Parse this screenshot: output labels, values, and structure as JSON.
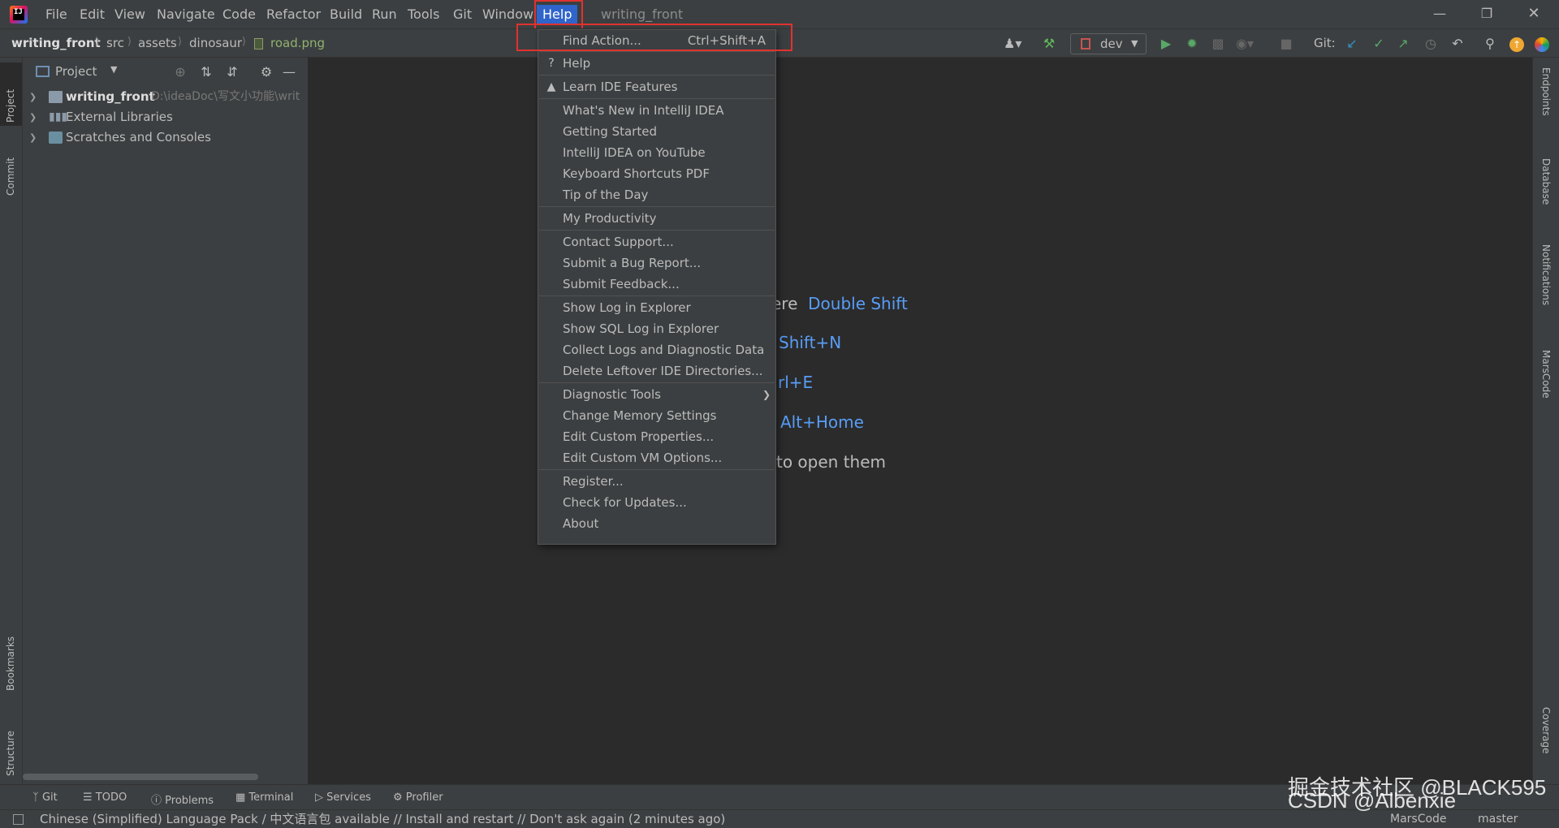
{
  "menubar": {
    "items": [
      "File",
      "Edit",
      "View",
      "Navigate",
      "Code",
      "Refactor",
      "Build",
      "Run",
      "Tools",
      "Git",
      "Window",
      "Help"
    ],
    "project_title": "writing_front",
    "logo_text": "IJ"
  },
  "navbar": {
    "crumbs": [
      "writing_front",
      "src",
      "assets",
      "dinosaur",
      "road.png"
    ],
    "run_config": "dev",
    "git_label": "Git:"
  },
  "left_tabs": [
    "Project",
    "Commit",
    "Bookmarks",
    "Structure"
  ],
  "right_tabs": [
    "Endpoints",
    "Database",
    "Notifications",
    "MarsCode",
    "Coverage"
  ],
  "project_panel": {
    "title": "Project",
    "tree": [
      {
        "name": "writing_front",
        "path": "D:\\ideaDoc\\写文小功能\\writ"
      },
      {
        "name": "External Libraries",
        "path": ""
      },
      {
        "name": "Scratches and Consoles",
        "path": ""
      }
    ]
  },
  "editor_hints": [
    {
      "text": "ere",
      "key": "Double Shift"
    },
    {
      "text": "",
      "key": "Shift+N"
    },
    {
      "text": "",
      "key": "rl+E"
    },
    {
      "text": "",
      "key": "Alt+Home"
    },
    {
      "text": "to open them",
      "key": ""
    }
  ],
  "help_menu": {
    "items": [
      {
        "label": "Find Action...",
        "shortcut": "Ctrl+Shift+A"
      },
      {
        "label": "Help"
      },
      {
        "label": "Learn IDE Features"
      },
      {
        "label": "What's New in IntelliJ IDEA"
      },
      {
        "label": "Getting Started"
      },
      {
        "label": "IntelliJ IDEA on YouTube"
      },
      {
        "label": "Keyboard Shortcuts PDF"
      },
      {
        "label": "Tip of the Day"
      },
      {
        "label": "My Productivity"
      },
      {
        "label": "Contact Support..."
      },
      {
        "label": "Submit a Bug Report..."
      },
      {
        "label": "Submit Feedback..."
      },
      {
        "label": "Show Log in Explorer"
      },
      {
        "label": "Show SQL Log in Explorer"
      },
      {
        "label": "Collect Logs and Diagnostic Data"
      },
      {
        "label": "Delete Leftover IDE Directories..."
      },
      {
        "label": "Diagnostic Tools"
      },
      {
        "label": "Change Memory Settings"
      },
      {
        "label": "Edit Custom Properties..."
      },
      {
        "label": "Edit Custom VM Options..."
      },
      {
        "label": "Register..."
      },
      {
        "label": "Check for Updates..."
      },
      {
        "label": "About"
      }
    ]
  },
  "bottom_tools": [
    "Git",
    "TODO",
    "Problems",
    "Terminal",
    "Services",
    "Profiler"
  ],
  "status": {
    "message": "Chinese (Simplified) Language Pack / 中文语言包 available // Install and restart // Don't ask again (2 minutes ago)",
    "marscode": "MarsCode",
    "branch": "master"
  },
  "watermark": "掘金技术社区 @BLACK595\nCSDN @Albenxie",
  "colors": {
    "accent": "#2f65ca",
    "highlight_box": "#e0322f",
    "link": "#589df6",
    "background": "#2b2b2b",
    "panel": "#3c3f41"
  }
}
